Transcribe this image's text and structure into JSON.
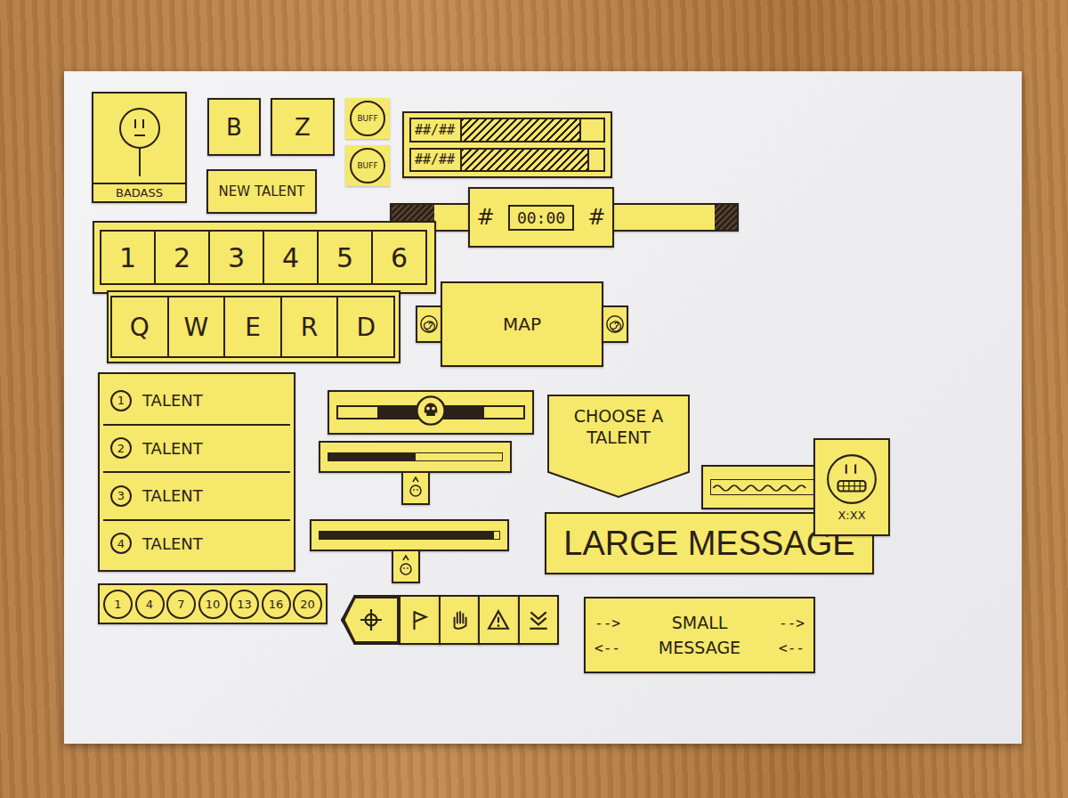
{
  "portrait": {
    "label": "BADASS"
  },
  "keys_small": [
    {
      "label": "B"
    },
    {
      "label": "Z"
    }
  ],
  "buffs": [
    {
      "label": "BUFF"
    },
    {
      "label": "BUFF"
    }
  ],
  "new_talent": {
    "label": "NEW TALENT"
  },
  "resource_bars": [
    {
      "reading": "##/##",
      "level": 0.84
    },
    {
      "reading": "##/##",
      "level": 0.9
    }
  ],
  "match_timer": {
    "left_score": "#",
    "time": "00:00",
    "right_score": "#",
    "left_level": 0.55,
    "right_level": 0.18
  },
  "hotbar": [
    "1",
    "2",
    "3",
    "4",
    "5",
    "6"
  ],
  "ability_bar": [
    "Q",
    "W",
    "E",
    "R",
    "D"
  ],
  "map": {
    "label": "MAP"
  },
  "talents": [
    {
      "number": "1",
      "label": "TALENT"
    },
    {
      "number": "2",
      "label": "TALENT"
    },
    {
      "number": "3",
      "label": "TALENT"
    },
    {
      "number": "4",
      "label": "TALENT"
    }
  ],
  "tug_bar": {
    "level": 0.5
  },
  "progress_bars": [
    {
      "level": 0.5,
      "marker": 0.5
    },
    {
      "level": 0.97,
      "marker": 0.48
    }
  ],
  "choose_talent": {
    "label": "CHOOSE A TALENT"
  },
  "kill_message": {
    "timer": "X:XX"
  },
  "large_message": {
    "label": "LARGE MESSAGE"
  },
  "levels": [
    "1",
    "4",
    "7",
    "10",
    "13",
    "16",
    "20"
  ],
  "small_message": [
    {
      "left": "-->",
      "text": "SMALL",
      "right": "-->"
    },
    {
      "left": "<--",
      "text": "MESSAGE",
      "right": "<--"
    }
  ]
}
